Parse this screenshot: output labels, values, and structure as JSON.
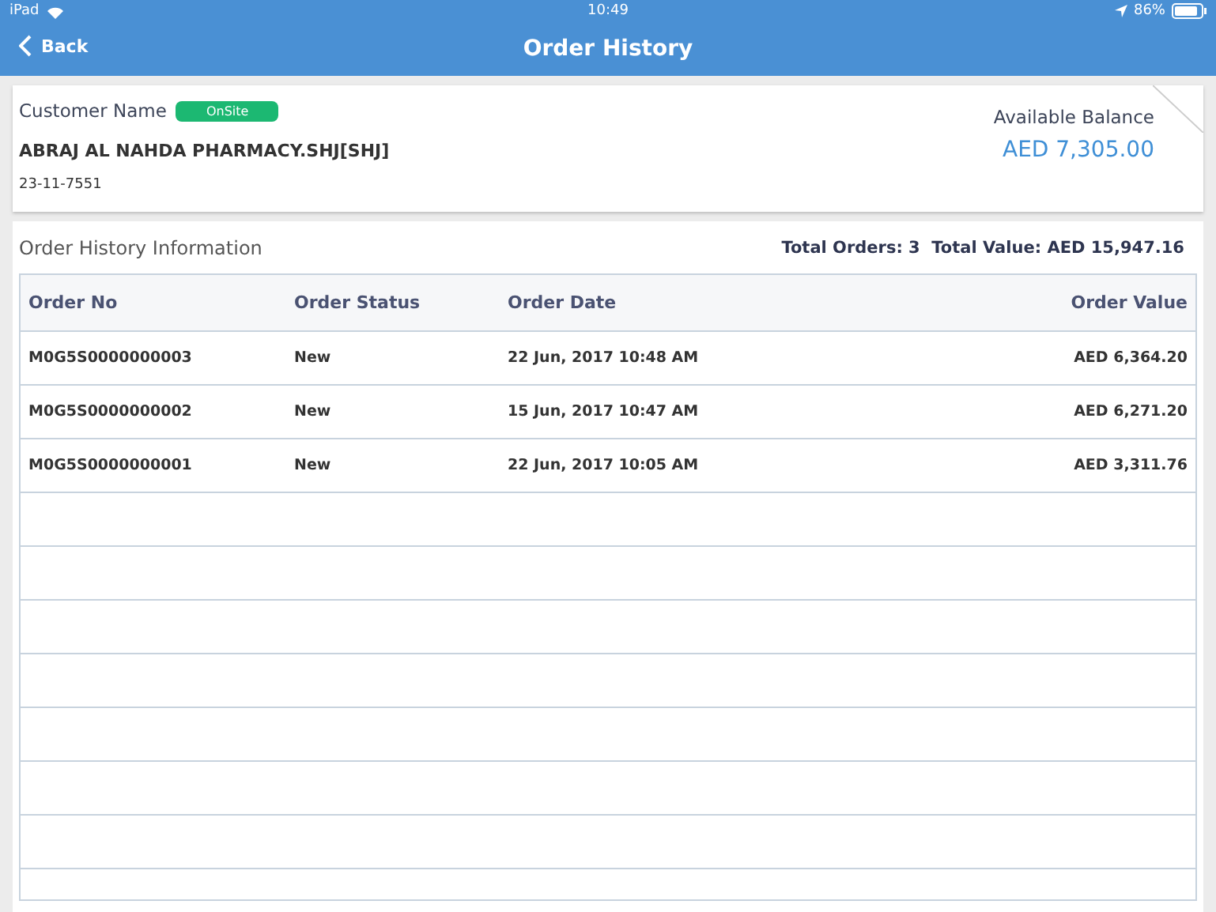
{
  "status_bar": {
    "device": "iPad",
    "time": "10:49",
    "battery_percent": "86%"
  },
  "nav": {
    "back": "Back",
    "title": "Order History"
  },
  "customer": {
    "label": "Customer Name",
    "badge": "OnSite",
    "name": "ABRAJ AL NAHDA PHARMACY.SHJ[SHJ]",
    "code": "23-11-7551",
    "balance_label": "Available Balance",
    "balance": "AED 7,305.00"
  },
  "orders": {
    "title": "Order History Information",
    "total_orders_label": "Total Orders:",
    "total_orders": "3",
    "total_value_label": "Total Value:",
    "total_value": "AED 15,947.16",
    "columns": [
      "Order No",
      "Order Status",
      "Order Date",
      "Order Value"
    ],
    "rows": [
      {
        "order_no": "M0G5S0000000003",
        "status": "New",
        "date": "22 Jun, 2017 10:48 AM",
        "value": "AED 6,364.20"
      },
      {
        "order_no": "M0G5S0000000002",
        "status": "New",
        "date": "15 Jun, 2017 10:47 AM",
        "value": "AED 6,271.20"
      },
      {
        "order_no": "M0G5S0000000001",
        "status": "New",
        "date": "22 Jun, 2017 10:05 AM",
        "value": "AED 3,311.76"
      }
    ]
  }
}
